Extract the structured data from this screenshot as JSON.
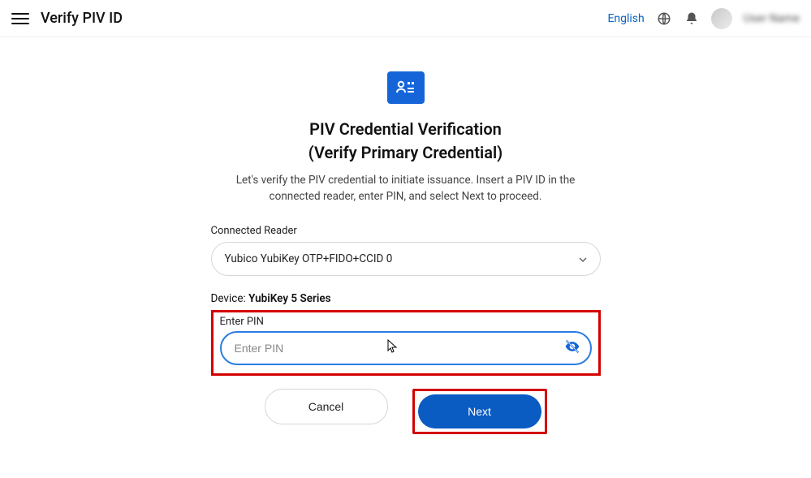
{
  "header": {
    "title": "Verify PIV ID",
    "language_label": "English",
    "user_name": "User Name"
  },
  "main": {
    "heading": "PIV Credential Verification",
    "subheading": "(Verify Primary Credential)",
    "instructions": "Let's verify the PIV credential to initiate issuance. Insert a PIV ID in the connected reader, enter PIN, and select Next to proceed."
  },
  "form": {
    "reader_label": "Connected Reader",
    "reader_selected": "Yubico YubiKey OTP+FIDO+CCID 0",
    "device_label": "Device:",
    "device_value": "YubiKey 5 Series",
    "pin_label": "Enter PIN",
    "pin_placeholder": "Enter PIN",
    "pin_value": ""
  },
  "buttons": {
    "cancel": "Cancel",
    "next": "Next"
  }
}
